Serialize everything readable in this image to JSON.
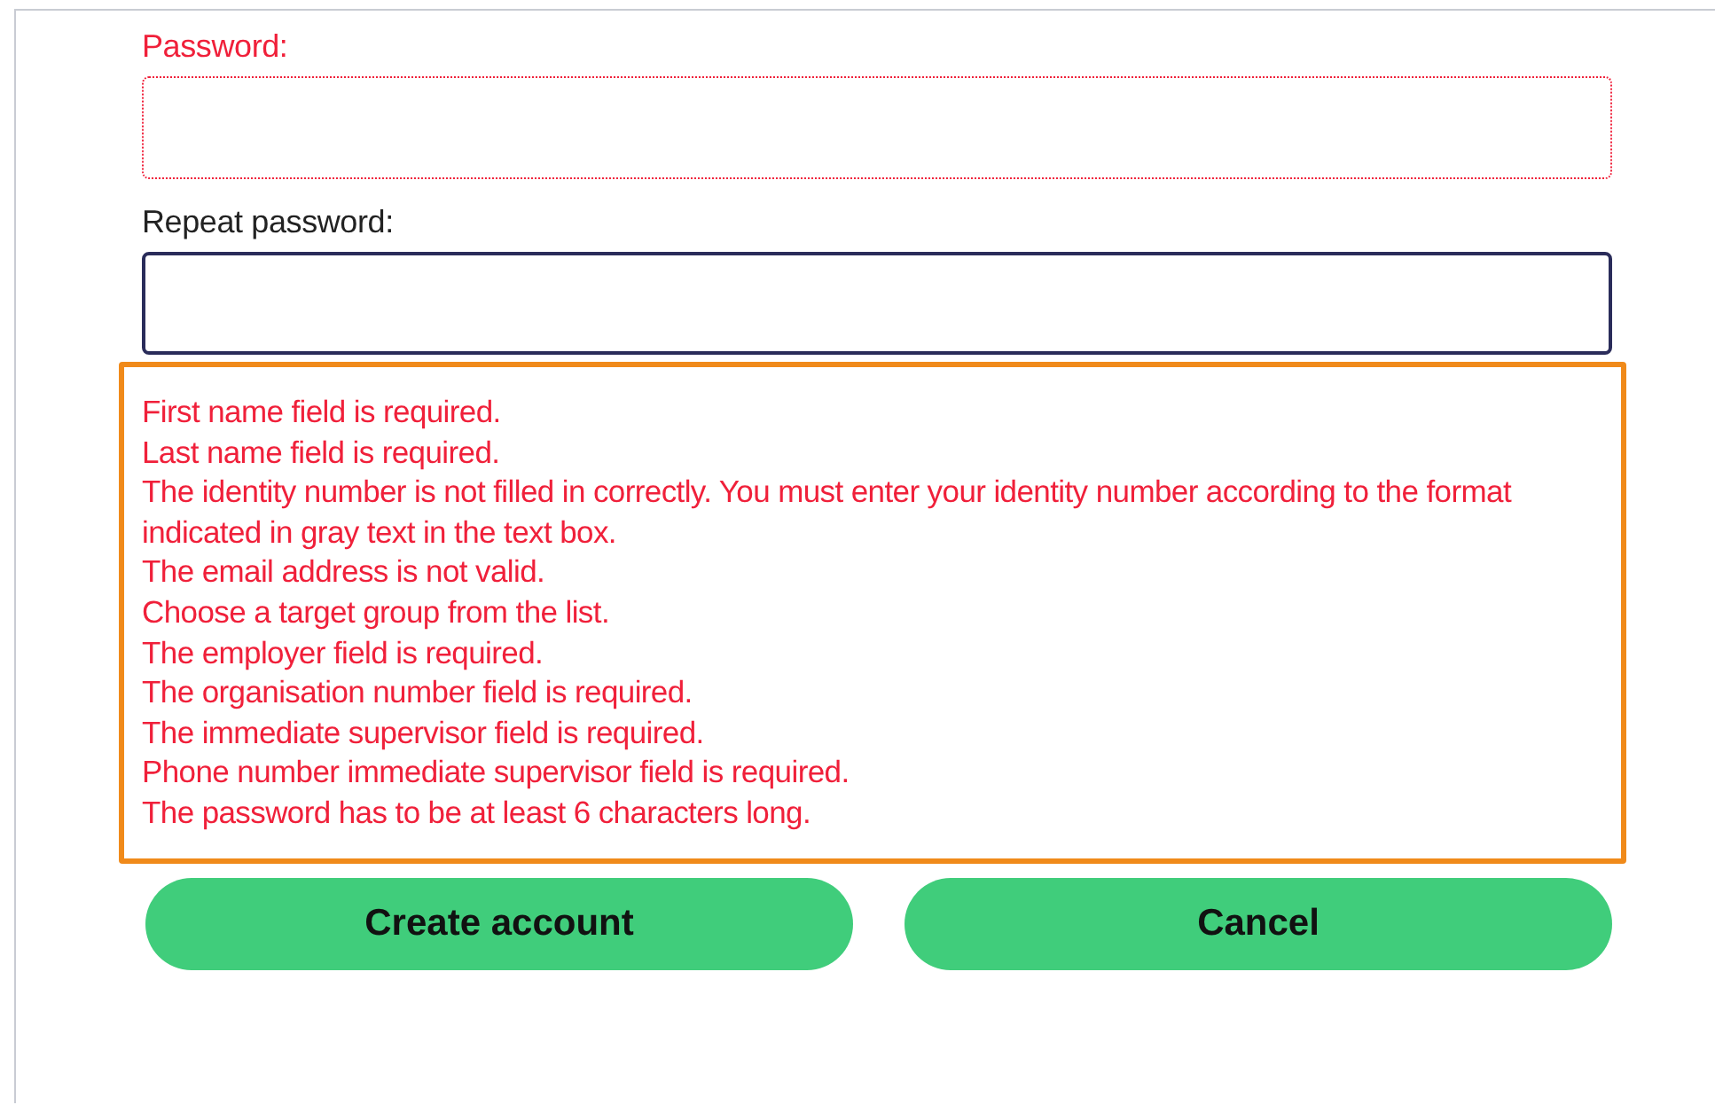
{
  "fields": [
    {
      "label": "Password:",
      "invalid": true
    },
    {
      "label": "Repeat password:",
      "invalid": false
    }
  ],
  "errors": {
    "highlighted": true,
    "messages": [
      "First name field is required.",
      "Last name field is required.",
      "The identity number is not filled in correctly. You must enter your identity number according to the format indicated in gray text in the text box.",
      "The email address is not valid.",
      "Choose a target group from the list.",
      "The employer field is required.",
      "The organisation number field is required.",
      "The immediate supervisor field is required.",
      "Phone number immediate supervisor field is required.",
      "The password has to be at least 6 characters long."
    ]
  },
  "buttons": [
    "Create account",
    "Cancel"
  ]
}
